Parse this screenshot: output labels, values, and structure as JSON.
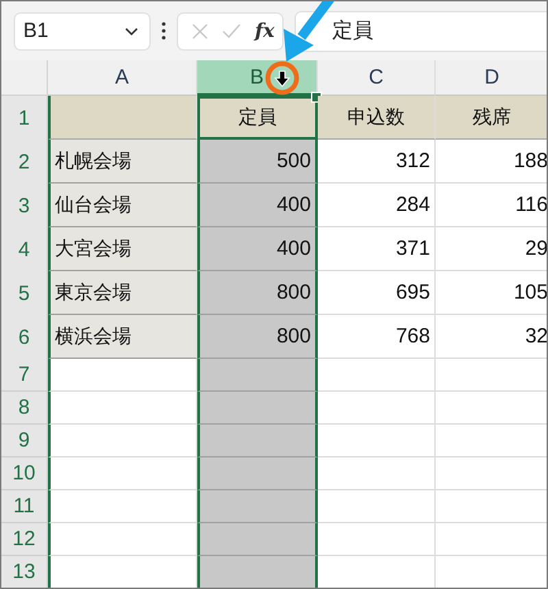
{
  "name_box": {
    "value": "B1"
  },
  "formula_bar": {
    "function_label": "fx",
    "value": "定員"
  },
  "columns": [
    {
      "label": "A",
      "selected": false
    },
    {
      "label": "B",
      "selected": true
    },
    {
      "label": "C",
      "selected": false
    },
    {
      "label": "D",
      "selected": false
    }
  ],
  "rows": [
    {
      "number": "1",
      "kind": "header",
      "cells": {
        "b": "定員",
        "c": "申込数",
        "d": "残席"
      }
    },
    {
      "number": "2",
      "kind": "data",
      "cells": {
        "a": "札幌会場",
        "b": "500",
        "c": "312",
        "d": "188"
      }
    },
    {
      "number": "3",
      "kind": "data",
      "cells": {
        "a": "仙台会場",
        "b": "400",
        "c": "284",
        "d": "116"
      }
    },
    {
      "number": "4",
      "kind": "data",
      "cells": {
        "a": "大宮会場",
        "b": "400",
        "c": "371",
        "d": "29"
      }
    },
    {
      "number": "5",
      "kind": "data",
      "cells": {
        "a": "東京会場",
        "b": "800",
        "c": "695",
        "d": "105"
      }
    },
    {
      "number": "6",
      "kind": "data",
      "cells": {
        "a": "横浜会場",
        "b": "800",
        "c": "768",
        "d": "32"
      }
    },
    {
      "number": "7",
      "kind": "empty"
    },
    {
      "number": "8",
      "kind": "empty"
    },
    {
      "number": "9",
      "kind": "empty"
    },
    {
      "number": "10",
      "kind": "empty"
    },
    {
      "number": "11",
      "kind": "empty"
    },
    {
      "number": "12",
      "kind": "empty"
    },
    {
      "number": "13",
      "kind": "empty"
    }
  ]
}
